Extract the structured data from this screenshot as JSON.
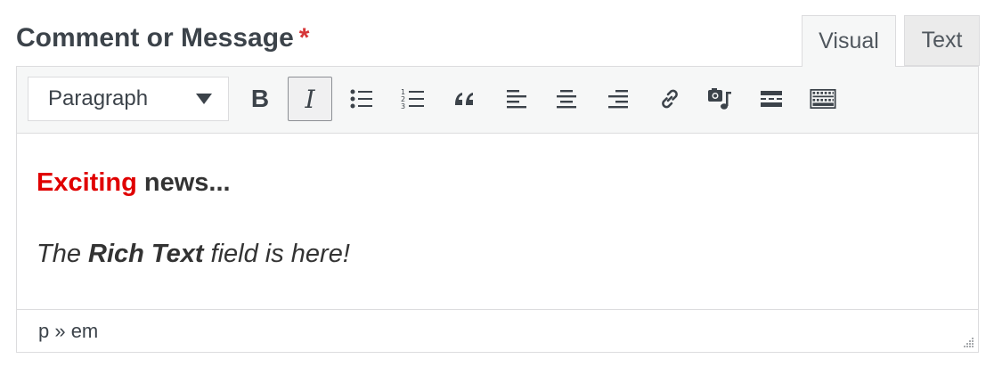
{
  "field": {
    "label": "Comment or Message",
    "required_marker": "*"
  },
  "tabs": {
    "visual": "Visual",
    "text": "Text",
    "active": "Visual"
  },
  "toolbar": {
    "format_select": "Paragraph",
    "buttons": [
      {
        "name": "bold",
        "icon": "bold-icon",
        "glyph": "B"
      },
      {
        "name": "italic",
        "icon": "italic-icon",
        "glyph": "I",
        "active": true
      },
      {
        "name": "bulleted-list",
        "icon": "bulleted-list-icon"
      },
      {
        "name": "numbered-list",
        "icon": "numbered-list-icon"
      },
      {
        "name": "blockquote",
        "icon": "blockquote-icon"
      },
      {
        "name": "align-left",
        "icon": "align-left-icon"
      },
      {
        "name": "align-center",
        "icon": "align-center-icon"
      },
      {
        "name": "align-right",
        "icon": "align-right-icon"
      },
      {
        "name": "link",
        "icon": "link-icon"
      },
      {
        "name": "add-media",
        "icon": "media-icon"
      },
      {
        "name": "read-more",
        "icon": "read-more-icon"
      },
      {
        "name": "toolbar-toggle",
        "icon": "keyboard-icon"
      }
    ]
  },
  "content": {
    "line1_red": "Exciting",
    "line1_rest": " news...",
    "line2_a": "The ",
    "line2_bold": "Rich Text",
    "line2_b": " field is here!"
  },
  "status": {
    "path": "p » em"
  },
  "colors": {
    "accent_red": "#e00000",
    "required_red": "#d63638",
    "toolbar_bg": "#f6f7f7",
    "border": "#dcdcde"
  }
}
